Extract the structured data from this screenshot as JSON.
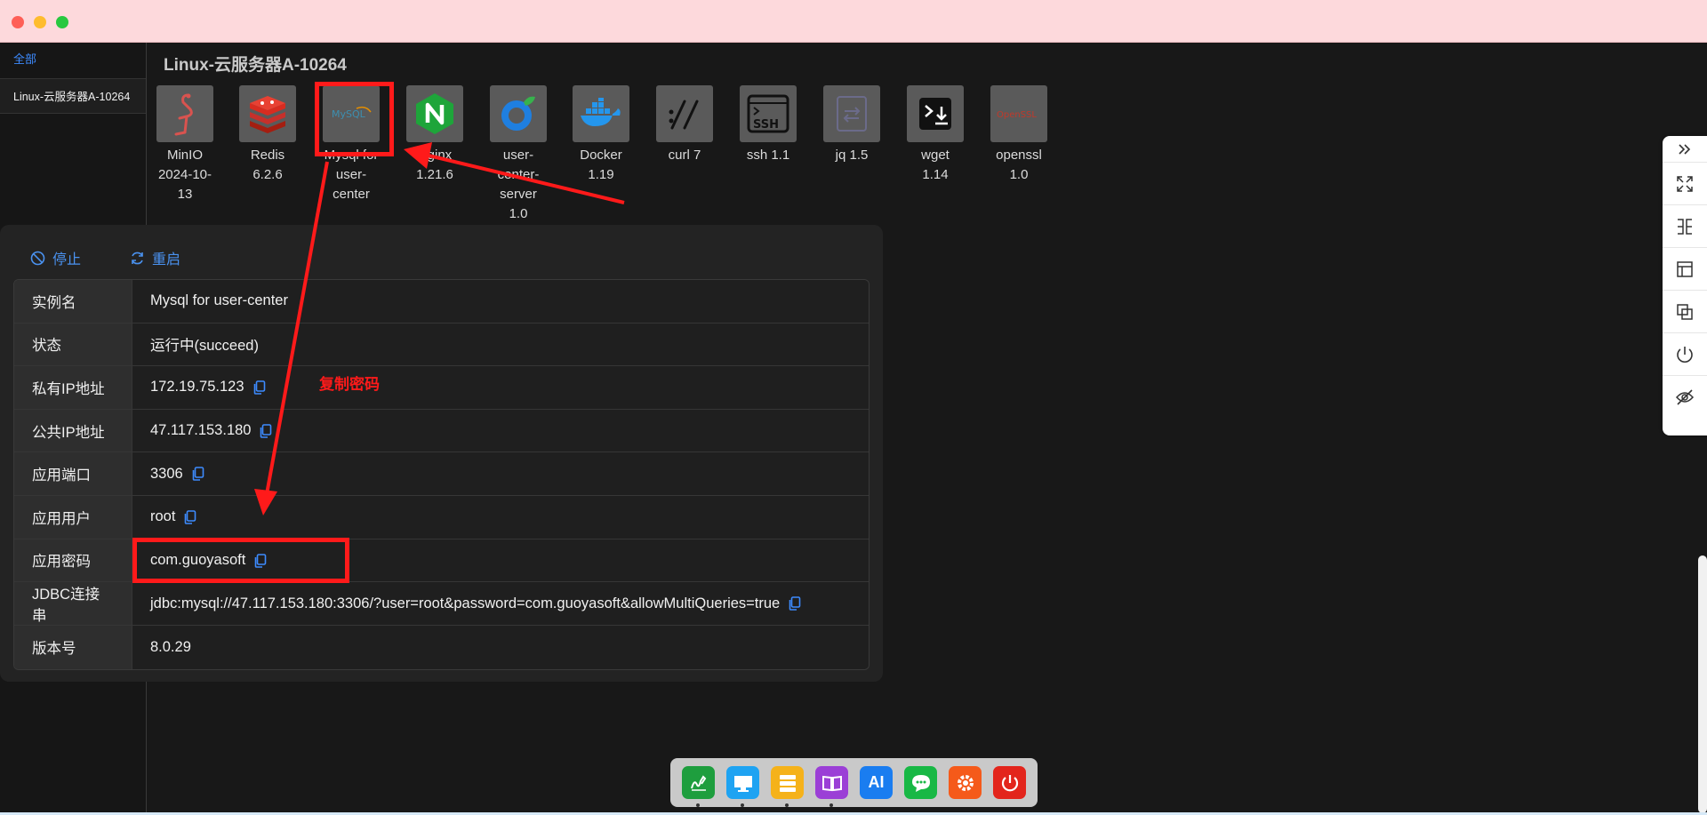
{
  "sidebar": {
    "all_tab": "全部",
    "server_item": "Linux-云服务器A-10264"
  },
  "server_title": "Linux-云服务器A-10264",
  "apps": [
    {
      "name": "MinIO",
      "version": "2024-10-13",
      "icon": "flamingo-icon"
    },
    {
      "name": "Redis",
      "version": "6.2.6",
      "icon": "redis-icon"
    },
    {
      "name": "Mysql for user-center",
      "version": "",
      "icon": "mysql-icon"
    },
    {
      "name": "Nginx",
      "version": "1.21.6",
      "icon": "nginx-icon"
    },
    {
      "name": "user-center-server",
      "version": "1.0",
      "icon": "java-app-icon"
    },
    {
      "name": "Docker",
      "version": "1.19",
      "icon": "docker-icon"
    },
    {
      "name": "curl",
      "version": "7",
      "icon": "curl-icon"
    },
    {
      "name": "ssh",
      "version": "1.1",
      "icon": "ssh-icon"
    },
    {
      "name": "jq",
      "version": "1.5",
      "icon": "jq-icon"
    },
    {
      "name": "wget",
      "version": "1.14",
      "icon": "terminal-download-icon"
    },
    {
      "name": "openssl",
      "version": "1.0",
      "icon": "openssl-icon"
    }
  ],
  "panel": {
    "stop_label": "停止",
    "restart_label": "重启",
    "rows": [
      {
        "key": "实例名",
        "value": "Mysql for user-center",
        "copy": false
      },
      {
        "key": "状态",
        "value": "运行中(succeed)",
        "copy": false
      },
      {
        "key": "私有IP地址",
        "value": "172.19.75.123",
        "copy": true
      },
      {
        "key": "公共IP地址",
        "value": "47.117.153.180",
        "copy": true
      },
      {
        "key": "应用端口",
        "value": "3306",
        "copy": true
      },
      {
        "key": "应用用户",
        "value": "root",
        "copy": true
      },
      {
        "key": "应用密码",
        "value": "com.guoyasoft",
        "copy": true
      },
      {
        "key": "JDBC连接串",
        "value": "jdbc:mysql://47.117.153.180:3306/?user=root&password=com.guoyasoft&allowMultiQueries=true",
        "copy": true
      },
      {
        "key": "版本号",
        "value": "8.0.29",
        "copy": false
      }
    ]
  },
  "annotation": {
    "label": "复制密码",
    "color": "#ff1a1a"
  },
  "toolstrip": [
    "expand-right-icon",
    "fullscreen-icon",
    "split-view-icon",
    "layout-icon",
    "copy-window-icon",
    "power-icon",
    "hide-icon"
  ],
  "dock": [
    {
      "icon": "signature-app-icon",
      "color": "#1e9e3e",
      "label": "",
      "dot": true
    },
    {
      "icon": "desktop-icon",
      "color": "#1ea3f2",
      "label": "",
      "dot": true
    },
    {
      "icon": "server-icon",
      "color": "#f5b21a",
      "label": "",
      "dot": true
    },
    {
      "icon": "book-icon",
      "color": "#9b3fd6",
      "label": "",
      "dot": true
    },
    {
      "icon": "ai-icon",
      "color": "#1a7df0",
      "label": "AI",
      "dot": false
    },
    {
      "icon": "chat-icon",
      "color": "#18b845",
      "label": "",
      "dot": false
    },
    {
      "icon": "settings-icon",
      "color": "#f55a1a",
      "label": "",
      "dot": false
    },
    {
      "icon": "power-icon",
      "color": "#e3251c",
      "label": "",
      "dot": false
    }
  ],
  "colors": {
    "accent": "#3d8bff",
    "annotation": "#ff1a1a",
    "panel": "#232323"
  }
}
